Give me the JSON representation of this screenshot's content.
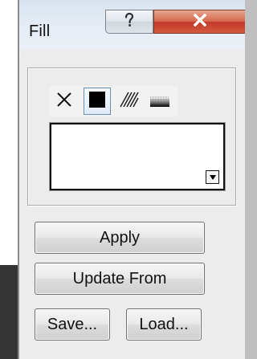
{
  "window": {
    "title": "Fill",
    "help_glyph": "?",
    "close_glyph": "x"
  },
  "fill_types": [
    {
      "name": "none",
      "icon": "x-icon",
      "active": false
    },
    {
      "name": "solid",
      "icon": "solid-square-icon",
      "active": true
    },
    {
      "name": "hatch",
      "icon": "hatch-pattern-icon",
      "active": false
    },
    {
      "name": "gradient",
      "icon": "gradient-icon",
      "active": false
    }
  ],
  "preview": {
    "dropdown_icon": "triangle-down-icon"
  },
  "buttons": {
    "apply": "Apply",
    "update_from": "Update From",
    "save": "Save...",
    "load": "Load..."
  },
  "colors": {
    "close_button": "#c1392b",
    "active_tool_border": "#6b8bb8",
    "window_bg": "#ececec"
  }
}
